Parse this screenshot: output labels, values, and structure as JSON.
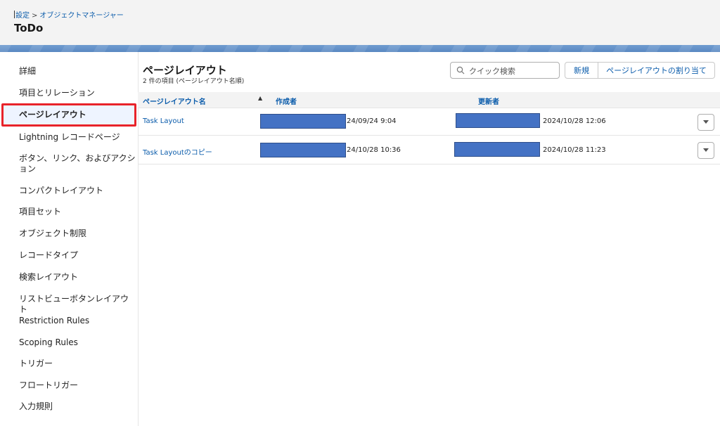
{
  "header": {
    "breadcrumb": [
      "設定",
      "オブジェクトマネージャー"
    ],
    "breadcrumb_separator": ">",
    "title": "ToDo"
  },
  "sidebar": {
    "items": [
      {
        "label": "詳細"
      },
      {
        "label": "項目とリレーション"
      },
      {
        "label": "ページレイアウト",
        "selected": true
      },
      {
        "label": "Lightning レコードページ"
      },
      {
        "label": "ボタン、リンク、およびアクション"
      },
      {
        "label": "コンパクトレイアウト"
      },
      {
        "label": "項目セット"
      },
      {
        "label": "オブジェクト制限"
      },
      {
        "label": "レコードタイプ"
      },
      {
        "label": "検索レイアウト"
      },
      {
        "label": "リストビューボタンレイアウト"
      },
      {
        "label": "Restriction Rules"
      },
      {
        "label": "Scoping Rules"
      },
      {
        "label": "トリガー"
      },
      {
        "label": "フロートリガー"
      },
      {
        "label": "入力規則"
      }
    ]
  },
  "main": {
    "title": "ページレイアウト",
    "subtitle": "2 件の項目 (ページレイアウト名順)",
    "search_placeholder": "クイック検索",
    "new_button": "新規",
    "assign_button": "ページレイアウトの割り当て",
    "columns": [
      "ページレイアウト名",
      "作成者",
      "更新者"
    ],
    "sort_indicator": "▲",
    "rows": [
      {
        "name": "Task Layout",
        "created": "24/09/24 9:04",
        "modified": "2024/10/28 12:06"
      },
      {
        "name": "Task Layoutのコピー",
        "created": "24/10/28 10:36",
        "modified": "2024/10/28 11:23"
      }
    ]
  },
  "colors": {
    "link": "#0b5cab",
    "selection_border": "#e8232a",
    "redaction": "#4472c4",
    "band": "#5a88c2"
  },
  "icons": {
    "search": "search-icon",
    "row_menu": "chevron-down-icon"
  }
}
